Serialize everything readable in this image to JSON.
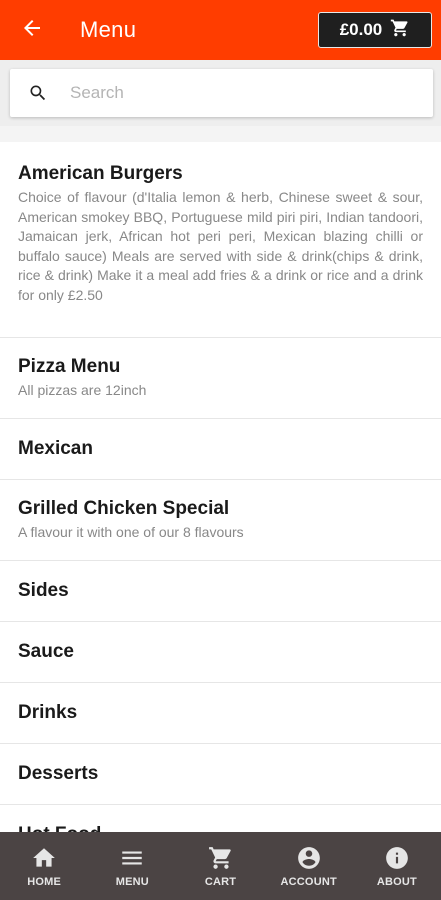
{
  "appbar": {
    "title": "Menu",
    "cart_total": "£0.00",
    "back_icon": "arrow-back-icon",
    "cart_icon": "cart-icon",
    "color": "#ff3d00"
  },
  "search": {
    "placeholder": "Search",
    "value": ""
  },
  "menu": {
    "items": [
      {
        "title": "American Burgers",
        "description": "Choice of flavour (d'Italia lemon & herb, Chinese sweet & sour, American smokey BBQ, Portuguese mild piri piri, Indian tandoori, Jamaican jerk, African hot peri peri, Mexican blazing chilli or buffalo sauce) Meals are served with side & drink(chips & drink, rice & drink) Make it a meal add fries & a drink or rice and a drink for only £2.50"
      },
      {
        "title": "Pizza Menu",
        "description": "All pizzas are 12inch"
      },
      {
        "title": "Mexican"
      },
      {
        "title": "Grilled Chicken Special",
        "description": "A flavour it with one of our 8 flavours"
      },
      {
        "title": "Sides"
      },
      {
        "title": "Sauce"
      },
      {
        "title": "Drinks"
      },
      {
        "title": "Desserts"
      },
      {
        "title": "Hot Food"
      }
    ]
  },
  "bottom_nav": {
    "items": [
      {
        "label": "HOME",
        "icon": "home-icon"
      },
      {
        "label": "MENU",
        "icon": "menu-icon"
      },
      {
        "label": "CART",
        "icon": "cart-icon"
      },
      {
        "label": "ACCOUNT",
        "icon": "account-icon"
      },
      {
        "label": "ABOUT",
        "icon": "info-icon"
      }
    ],
    "background": "#4b4444"
  }
}
